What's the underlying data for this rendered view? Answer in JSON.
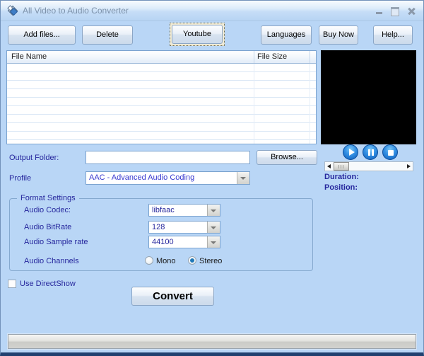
{
  "window": {
    "title": "All Video to Audio Converter",
    "controls": {
      "minimize": "minimize",
      "maximize": "maximize",
      "close": "close"
    }
  },
  "toolbar": {
    "buttons": [
      {
        "id": "add-files",
        "label": "Add files..."
      },
      {
        "id": "delete",
        "label": "Delete"
      },
      {
        "id": "youtube",
        "label": "Youtube",
        "focused": true
      },
      {
        "id": "languages",
        "label": "Languages"
      },
      {
        "id": "buy-now",
        "label": "Buy Now"
      },
      {
        "id": "help",
        "label": "Help..."
      }
    ]
  },
  "file_list": {
    "columns": [
      "File Name",
      "File Size"
    ],
    "rows": []
  },
  "playback": {
    "buttons": [
      "play",
      "pause",
      "stop"
    ],
    "duration_label": "Duration:",
    "position_label": "Position:"
  },
  "output": {
    "label": "Output Folder:",
    "value": "",
    "browse_label": "Browse..."
  },
  "profile": {
    "label": "Profile",
    "value": "AAC - Advanced Audio Coding"
  },
  "format_settings": {
    "title": "Format Settings",
    "audio_codec": {
      "label": "Audio Codec:",
      "value": "libfaac"
    },
    "audio_bitrate": {
      "label": "Audio BitRate",
      "value": "128"
    },
    "audio_sample_rate": {
      "label": "Audio Sample rate",
      "value": "44100"
    },
    "audio_channels": {
      "label": "Audio Channels",
      "options": [
        {
          "label": "Mono",
          "selected": false
        },
        {
          "label": "Stereo",
          "selected": true
        }
      ]
    }
  },
  "directshow": {
    "label": "Use DirectShow",
    "checked": false
  },
  "convert": {
    "label": "Convert"
  },
  "icons": {
    "app": "app-diamond-icon",
    "play": "play-icon",
    "pause": "pause-icon",
    "stop": "stop-icon",
    "combo_arrow": "chevron-down-icon"
  },
  "colors": {
    "window_bg": "#b9d6f6",
    "label_text": "#26279d",
    "profile_text": "#3939cf",
    "title_text": "#7d92aa",
    "player_button": "#1668c8",
    "bottom_border": "#21406f"
  }
}
